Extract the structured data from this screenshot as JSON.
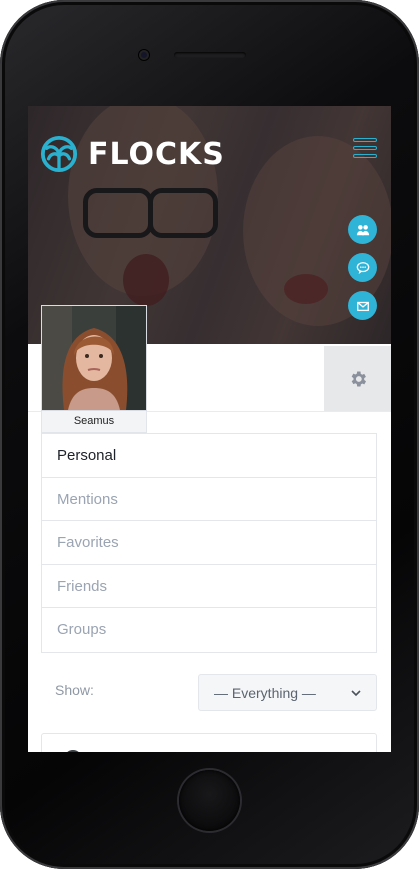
{
  "brand": {
    "name": "FLOCKS",
    "accent": "#2ab1d0"
  },
  "header": {
    "menu_icon": "hamburger-icon",
    "side_actions": [
      {
        "icon": "users-icon"
      },
      {
        "icon": "chat-icon"
      },
      {
        "icon": "mail-icon"
      }
    ]
  },
  "profile": {
    "name": "Seamus",
    "settings_icon": "gear-icon"
  },
  "nav": {
    "items": [
      {
        "label": "Personal",
        "active": true
      },
      {
        "label": "Mentions",
        "active": false
      },
      {
        "label": "Favorites",
        "active": false
      },
      {
        "label": "Friends",
        "active": false
      },
      {
        "label": "Groups",
        "active": false
      }
    ]
  },
  "filter": {
    "label": "Show:",
    "selected": "— Everything —"
  }
}
